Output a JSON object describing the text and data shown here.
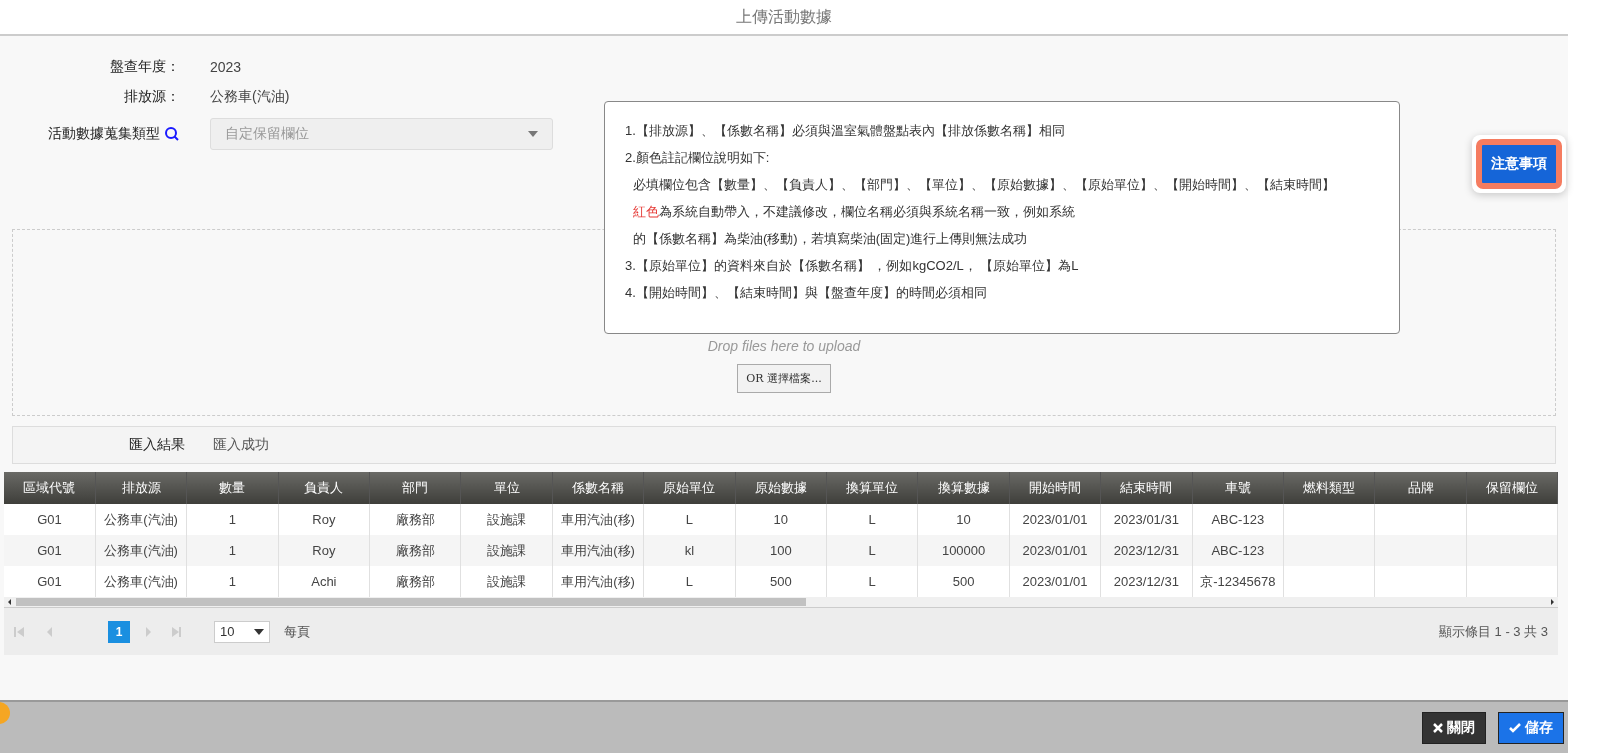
{
  "window": {
    "title": "上傳活動數據"
  },
  "form": [
    {
      "label": "盤查年度：",
      "value": "2023",
      "kind": "text"
    },
    {
      "label": "排放源：",
      "value": "公務車(汽油)",
      "kind": "text"
    },
    {
      "label": "活動數據蒐集類型",
      "value": "自定保留欄位",
      "kind": "select",
      "disabled": true
    }
  ],
  "notice": {
    "lines": [
      {
        "kind": "item",
        "text": "1.【排放源】、【係數名稱】必須與溫室氣體盤點表內【排放係數名稱】相同"
      },
      {
        "kind": "item",
        "text": "2.顏色註記欄位說明如下:"
      },
      {
        "kind": "sub",
        "text": "必填欄位包含【數量】、【負責人】、【部門】、【單位】、【原始數據】、【原始單位】、【開始時間】、【結束時間】"
      },
      {
        "kind": "sub",
        "lead": "紅色",
        "text": "為系統自動帶入，不建議修改，欄位名稱必須與系統名稱一致，例如系統"
      },
      {
        "kind": "sub",
        "text": "的【係數名稱】為柴油(移動)，若填寫柴油(固定)進行上傳則無法成功"
      },
      {
        "kind": "item",
        "text": "3.【原始單位】的資料來自於【係數名稱】 ，例如kgCO2/L， 【原始單位】為L"
      },
      {
        "kind": "item",
        "text": "4.【開始時間】、【結束時間】與【盤查年度】的時間必須相同"
      }
    ]
  },
  "notice_button": {
    "label": "注意事項"
  },
  "dropzone": {
    "hint": "Drop files here to upload",
    "button": "OR 選擇檔案..."
  },
  "import_result": {
    "label": "匯入結果",
    "value": "匯入成功"
  },
  "table": {
    "columns": [
      "區域代號",
      "排放源",
      "數量",
      "負責人",
      "部門",
      "單位",
      "係數名稱",
      "原始單位",
      "原始數據",
      "換算單位",
      "換算數據",
      "開始時間",
      "結束時間",
      "車號",
      "燃料類型",
      "品牌",
      "保留欄位"
    ],
    "rows": [
      [
        "G01",
        "公務車(汽油)",
        "1",
        "Roy",
        "廠務部",
        "設施課",
        "車用汽油(移)",
        "L",
        "10",
        "L",
        "10",
        "2023/01/01",
        "2023/01/31",
        "ABC-123",
        "",
        "",
        ""
      ],
      [
        "G01",
        "公務車(汽油)",
        "1",
        "Roy",
        "廠務部",
        "設施課",
        "車用汽油(移)",
        "kl",
        "100",
        "L",
        "100000",
        "2023/01/01",
        "2023/12/31",
        "ABC-123",
        "",
        "",
        ""
      ],
      [
        "G01",
        "公務車(汽油)",
        "1",
        "Achi",
        "廠務部",
        "設施課",
        "車用汽油(移)",
        "L",
        "500",
        "L",
        "500",
        "2023/01/01",
        "2023/12/31",
        "京-12345678",
        "",
        "",
        ""
      ]
    ]
  },
  "pager": {
    "pages": [
      {
        "label": "1",
        "selected": true
      }
    ],
    "page_size": "10",
    "per_page": "每頁",
    "summary": "顯示條目 1 - 3 共 3"
  },
  "footer": {
    "buttons": [
      {
        "label": "關閉",
        "kind": "close"
      },
      {
        "label": "儲存",
        "kind": "save"
      }
    ]
  }
}
